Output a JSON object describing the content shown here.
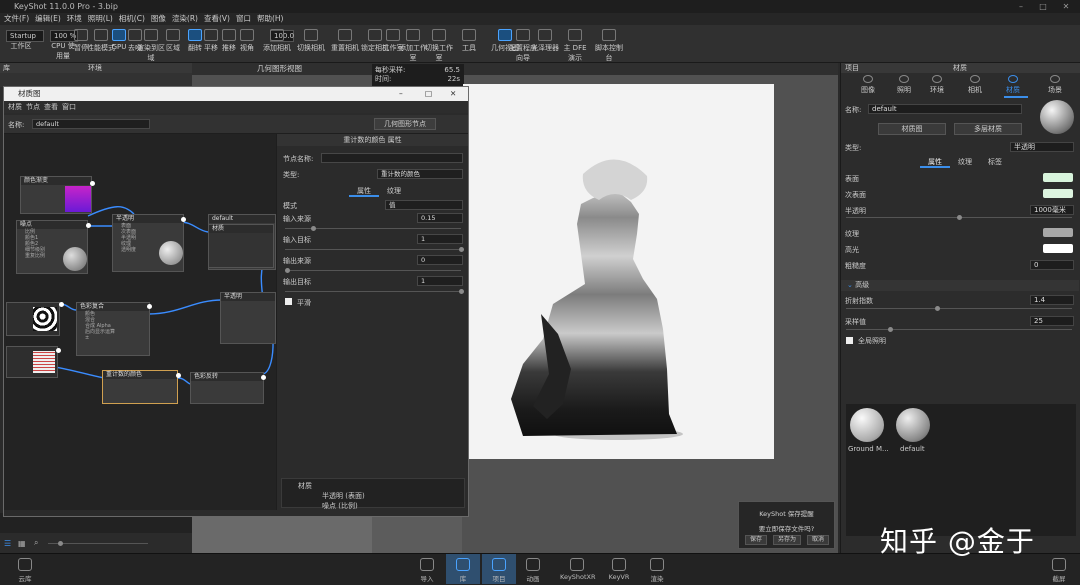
{
  "app": {
    "title": "KeyShot 11.0.0 Pro - 3.bip"
  },
  "menu": [
    "文件(F)",
    "编辑(E)",
    "环境",
    "照明(L)",
    "相机(C)",
    "图像",
    "渲染(R)",
    "查看(V)",
    "窗口",
    "帮助(H)"
  ],
  "ribbon": {
    "preset": "Startup",
    "zoom": "100 %",
    "fov": "100.0",
    "items": [
      "工作区",
      "CPU 使用量",
      "暂停",
      "性能模式",
      "GPU",
      "去噪",
      "渲染到区域",
      "区域",
      "翻转",
      "平移",
      "推移",
      "视角",
      "添加相机",
      "切换相机",
      "重置相机",
      "锁定相机",
      "工作室",
      "添加工作室",
      "切换工作室",
      "工具",
      "几何视图",
      "配置程序向导",
      "光泽理器",
      "主 DFE 演示",
      "脚本控制台"
    ]
  },
  "left_panel": {
    "title_left": "库",
    "title": "环境"
  },
  "viewport": {
    "title": "几何图形视图",
    "stats": {
      "fps_label": "每秒采样:",
      "fps_value": "65.5",
      "time_label": "时间:",
      "time_value": "22s"
    }
  },
  "material_window": {
    "title": "材质图",
    "menu": [
      "材质",
      "节点",
      "查看",
      "窗口"
    ],
    "name_label": "名称:",
    "name_value": "default",
    "geo_node_button": "几何图形节点",
    "nodes": {
      "color_gradient": "颜色渐变",
      "noise": "噪点",
      "translucent": "半透明",
      "default": "default",
      "material": "材质",
      "color_composite": "色彩复合",
      "opacity": "半透明",
      "color_remap": "重计数的颜色",
      "color_adjust": "色彩反转",
      "noise_ports": [
        "比例",
        "颜色1",
        "颜色2",
        "细节级别",
        "重复比例"
      ],
      "translucent_ports": [
        "表面",
        "次表面",
        "半透明",
        "纹理",
        "透明度"
      ],
      "composite_ports": [
        "颜色",
        "混合",
        "合成 Alpha",
        "后向显示运算",
        "±"
      ]
    },
    "props": {
      "header": "重计数的颜色 属性",
      "node_name_label": "节点名称:",
      "type_label": "类型:",
      "type_value": "重计数的颜色",
      "tab_props": "属性",
      "tab_texture": "纹理",
      "mode_label": "模式",
      "mode_value": "值",
      "input_from_label": "输入来源",
      "input_from_value": "0.15",
      "input_to_label": "输入目标",
      "input_to_value": "1",
      "output_from_label": "输出来源",
      "output_from_value": "0",
      "output_to_label": "输出目标",
      "output_to_value": "1",
      "smooth_label": "平滑"
    },
    "tree": {
      "root": "材质",
      "child": "半透明 (表面)",
      "sub": "噪点 (比例)"
    }
  },
  "right_panel": {
    "header_left": "项目",
    "header": "材质",
    "tabs": [
      "图像",
      "照明",
      "环境",
      "相机",
      "材质",
      "场景"
    ],
    "name_label": "名称:",
    "name_value": "default",
    "btn_graph": "材质图",
    "btn_multi": "多层材质",
    "type_label": "类型:",
    "type_value": "半透明",
    "subtabs": [
      "属性",
      "纹理",
      "标签"
    ],
    "surface_label": "表面",
    "subsurface_label": "次表面",
    "translucency_label": "半透明",
    "translucency_value": "1000毫米",
    "texture_label": "纹理",
    "specular_label": "高光",
    "roughness_label": "粗糙度",
    "roughness_value": "0",
    "advanced_label": "高级",
    "ior_label": "折射指数",
    "ior_value": "1.4",
    "samples_label": "采样值",
    "samples_value": "25",
    "global_label": "全局照明",
    "library_items": [
      "Ground M...",
      "default"
    ],
    "colors": {
      "surface": "#d8f4dc",
      "subsurface": "#dcf3df",
      "texture": "#a8a8a8",
      "specular": "#ffffff"
    }
  },
  "dialog": {
    "title": "KeyShot 保存提醒",
    "message": "要立即保存文件吗?",
    "save": "保存",
    "save_as": "另存为",
    "cancel": "取消"
  },
  "bottom_bar": {
    "cloud": "云库",
    "items": [
      "导入",
      "库",
      "项目",
      "动画",
      "KeyShotXR",
      "KeyVR",
      "渲染"
    ],
    "right": "截屏"
  },
  "watermark": "知乎 @金于"
}
